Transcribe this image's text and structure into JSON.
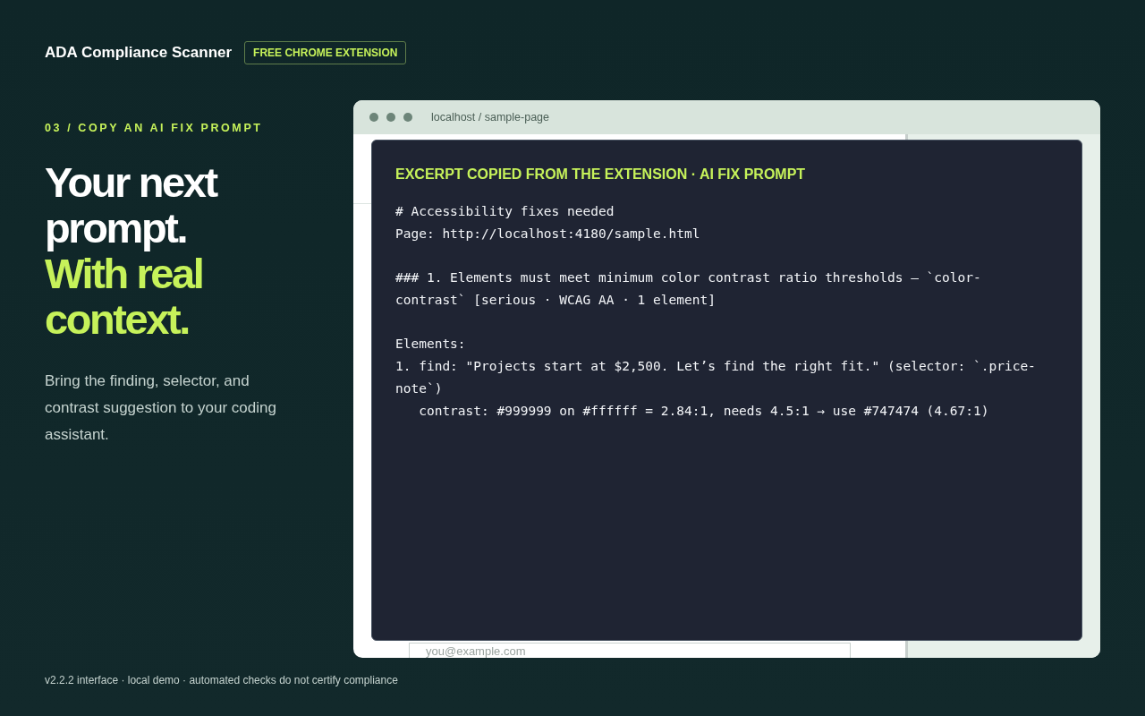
{
  "header": {
    "title": "ADA Compliance Scanner",
    "badge": "FREE CHROME EXTENSION"
  },
  "intro": {
    "eyebrow": "03 / COPY AN AI FIX PROMPT",
    "headline": [
      "Your next",
      "prompt."
    ],
    "headline_accent": [
      "With real",
      "context."
    ],
    "body": "Bring the finding, selector, and contrast suggestion to your coding assistant."
  },
  "browser": {
    "address": "localhost / sample-page",
    "email_field": {
      "placeholder": "you@example.com"
    },
    "prompt_card": {
      "title": "EXCERPT COPIED FROM THE EXTENSION · AI FIX PROMPT",
      "paragraphs": [
        [
          "# Accessibility fixes needed",
          "Page: http://localhost:4180/sample.html"
        ],
        [
          "### 1. Elements must meet minimum color contrast ratio thresholds — `color-",
          "contrast` [serious · WCAG AA · 1 element]"
        ],
        [
          "Elements:",
          "1. find: \"Projects start at $2,500. Let’s find the right fit.\" (selector: `.price-",
          "note`)",
          "   contrast: #999999 on #ffffff = 2.84:1, needs 4.5:1 → use #747474 (4.67:1)"
        ]
      ]
    }
  },
  "footer": "v2.2.2 interface · local demo · automated checks do not certify compliance"
}
